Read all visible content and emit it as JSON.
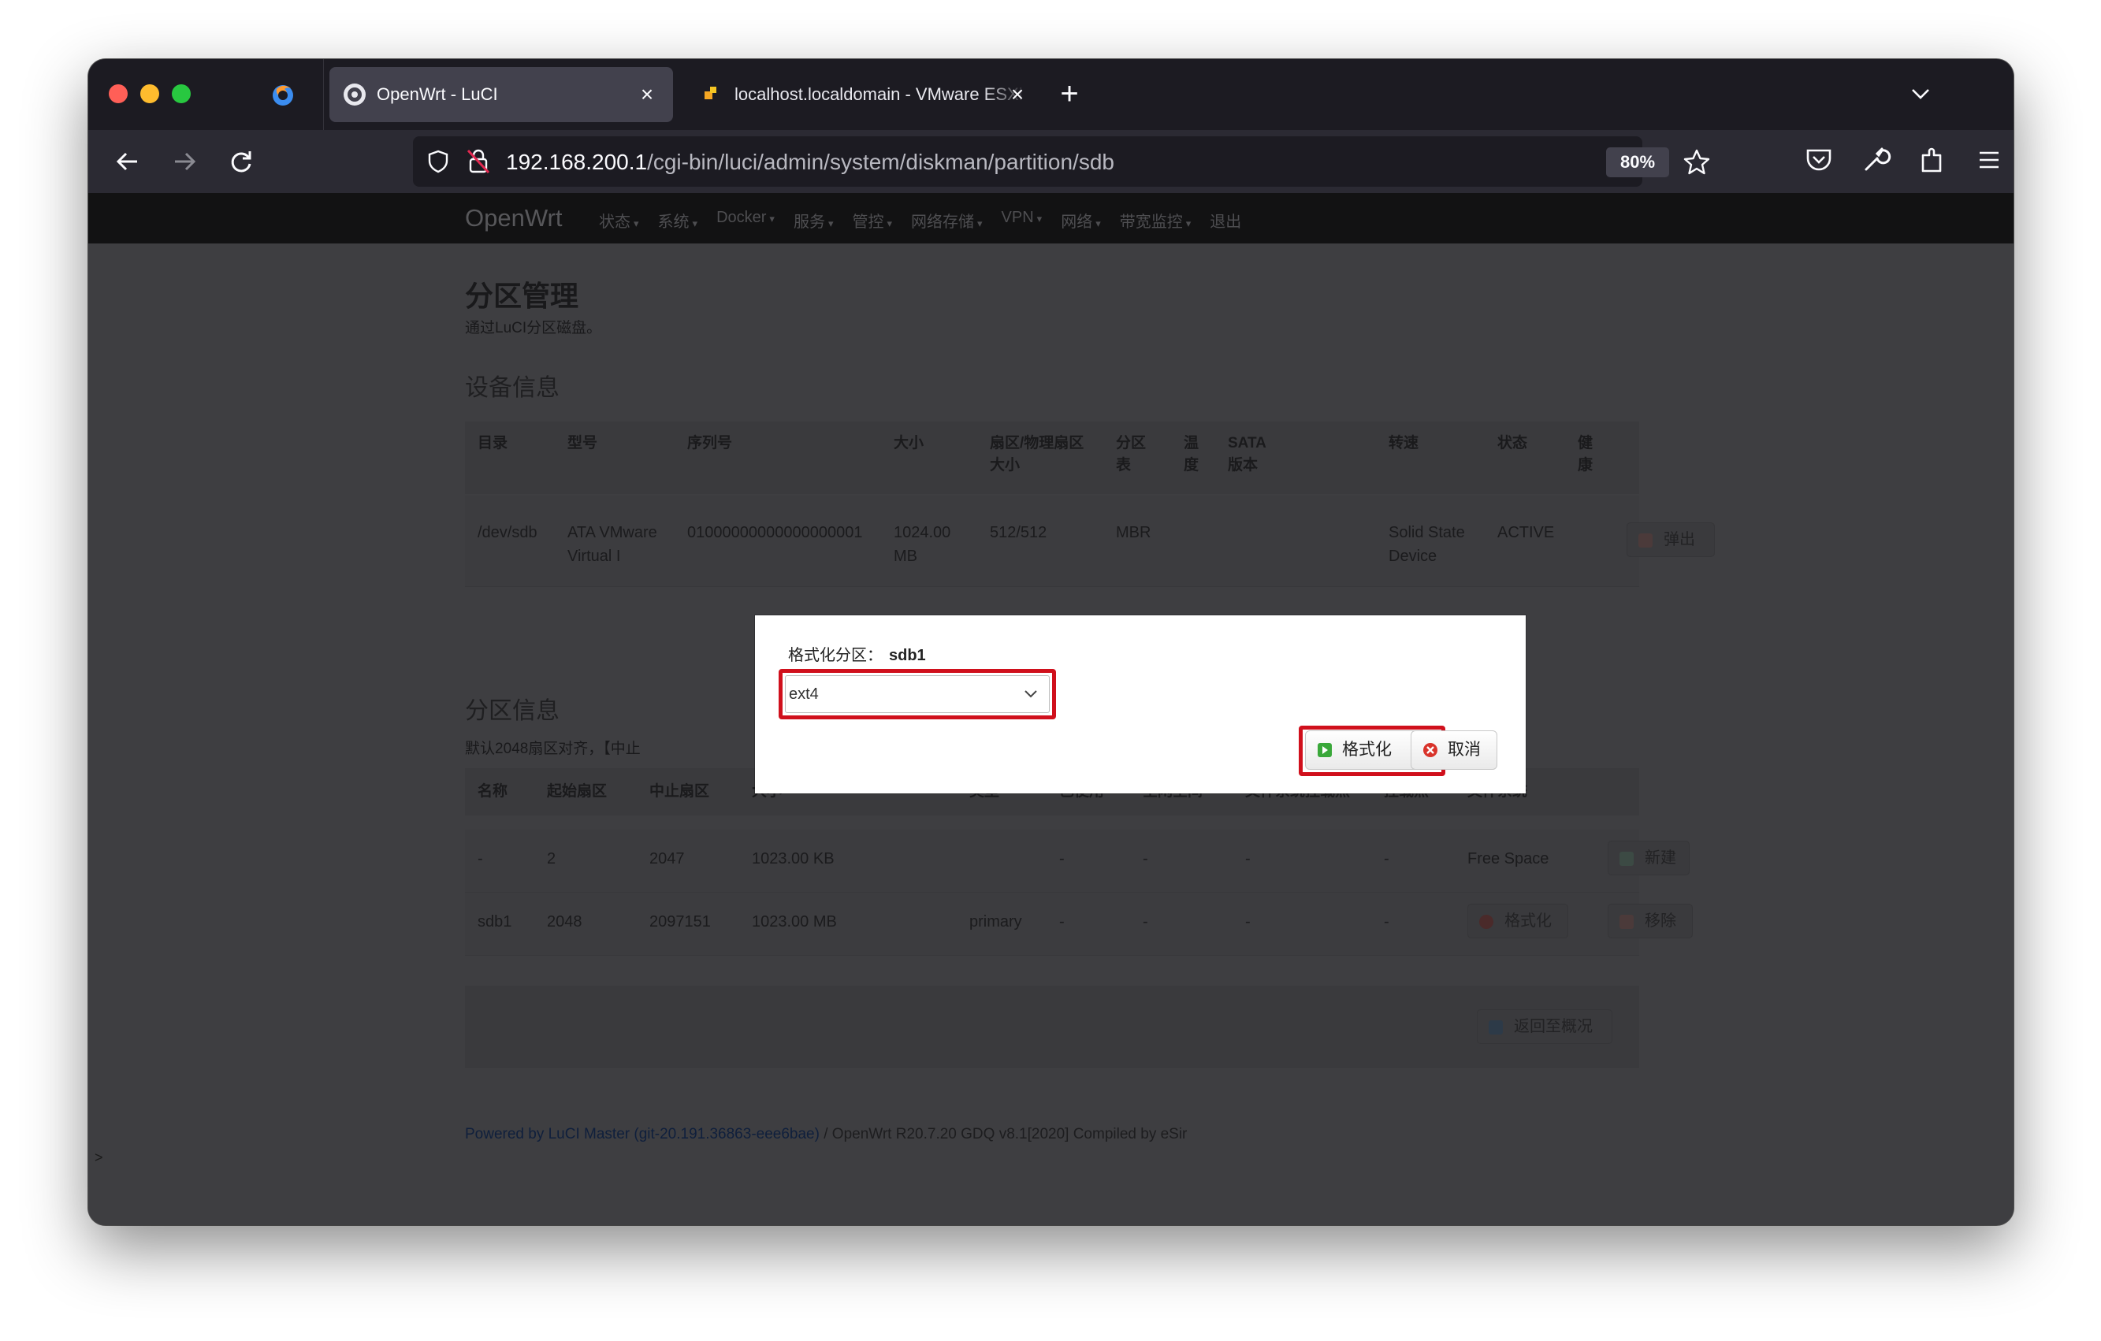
{
  "browser": {
    "tabs": [
      {
        "title": "OpenWrt - LuCI",
        "active": true
      },
      {
        "title": "localhost.localdomain - VMware ESXi",
        "active": false
      }
    ],
    "new_tab_label": "+",
    "url_host": "192.168.200.1",
    "url_path": "/cgi-bin/luci/admin/system/diskman/partition/sdb",
    "zoom": "80%"
  },
  "openwrt": {
    "brand": "OpenWrt",
    "menu": [
      "状态",
      "系统",
      "Docker",
      "服务",
      "管控",
      "网络存储",
      "VPN",
      "网络",
      "带宽监控",
      "退出"
    ],
    "logout": "退出"
  },
  "page": {
    "title": "分区管理",
    "description": "通过LuCI分区磁盘。",
    "device_section": {
      "title": "设备信息",
      "headers": [
        "目录",
        "型号",
        "序列号",
        "大小",
        "扇区/物理扇区大小",
        "分区表",
        "温度",
        "SATA版本",
        "转速",
        "状态",
        "健康"
      ],
      "row": {
        "path": "/dev/sdb",
        "model": "ATA VMware Virtual I",
        "serial": "01000000000000000001",
        "size": "1024.00 MB",
        "sector": "512/512",
        "table": "MBR",
        "speed": "Solid State Device",
        "status": "ACTIVE",
        "eject": "弹出"
      }
    },
    "partition_section": {
      "title": "分区信息",
      "desc": "默认2048扇区对齐，【中止",
      "headers": [
        "名称",
        "起始扇区",
        "中止扇区",
        "大小",
        "类型",
        "已使用",
        "空闲空间",
        "文件系统挂载点",
        "挂载点",
        "文件系统"
      ],
      "rows": [
        {
          "name": "-",
          "start": "2",
          "end": "2047",
          "size": "1023.00 KB",
          "type": "",
          "used": "-",
          "free": "-",
          "usage": "-",
          "mount": "-",
          "fs": "Free Space",
          "action1": "",
          "action2": "新建"
        },
        {
          "name": "sdb1",
          "start": "2048",
          "end": "2097151",
          "size": "1023.00 MB",
          "type": "primary",
          "used": "-",
          "free": "-",
          "usage": "-",
          "mount": "-",
          "fs": "",
          "action1": "格式化",
          "action2": "移除"
        }
      ],
      "back_button": "返回至概况"
    },
    "footer_link": "Powered by LuCI Master (git-20.191.36863-eee6bae)",
    "footer_rest": " / OpenWrt R20.7.20 GDQ v8.1[2020] Compiled by eSir",
    "caret": ">"
  },
  "modal": {
    "label": "格式化分区：",
    "partition": "sdb1",
    "filesystem_value": "ext4",
    "format_button": "格式化",
    "cancel_button": "取消"
  },
  "colors": {
    "highlight": "#d0101c",
    "format_icon": "#3aa83a",
    "cancel_icon": "#d9342b"
  }
}
